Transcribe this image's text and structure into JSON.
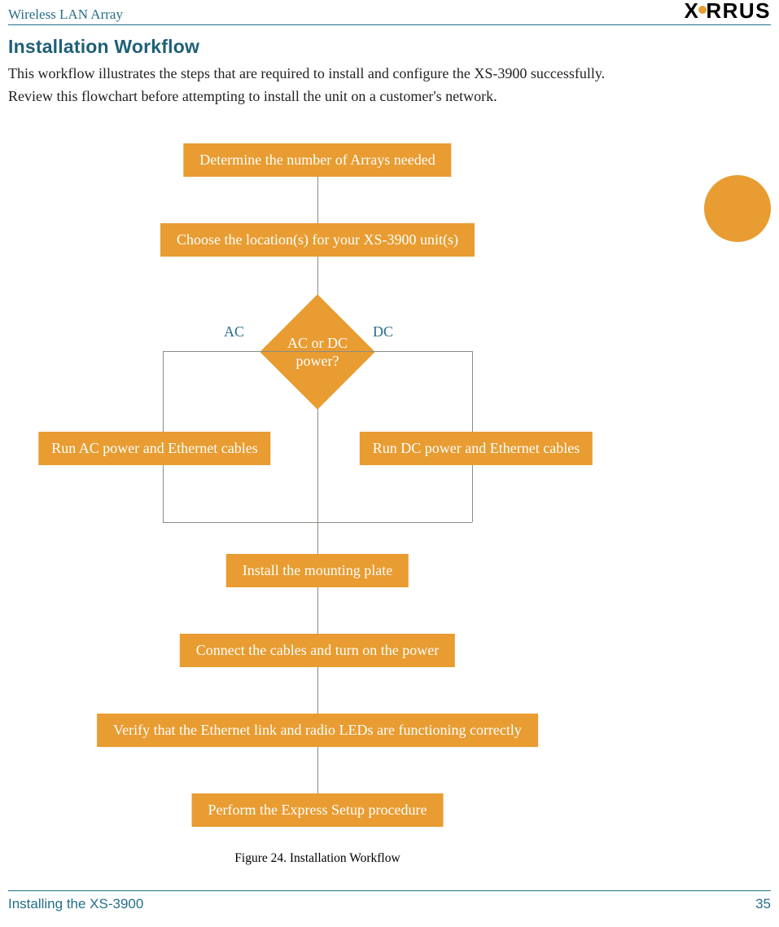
{
  "header": {
    "doc_title": "Wireless LAN Array",
    "brand_left": "X",
    "brand_right": "RRUS"
  },
  "section": {
    "title": "Installation Workflow",
    "intro": "This workflow illustrates the steps that are required to install and configure the XS-3900 successfully. Review this flowchart before attempting to install the unit on a customer's network."
  },
  "flow": {
    "step1": "Determine the number of Arrays needed",
    "step2": "Choose the location(s) for your XS-3900 unit(s)",
    "decision": "AC or DC\npower?",
    "branch_ac_label": "AC",
    "branch_dc_label": "DC",
    "branch_ac": "Run AC power and Ethernet cables",
    "branch_dc": "Run DC power and Ethernet cables",
    "step4": "Install the mounting plate",
    "step5": "Connect the cables and turn on the power",
    "step6": "Verify that the Ethernet link and radio LEDs are functioning correctly",
    "step7": "Perform the Express Setup procedure"
  },
  "caption": "Figure 24. Installation Workflow",
  "footer": {
    "left": "Installing the XS-3900",
    "page": "35"
  }
}
